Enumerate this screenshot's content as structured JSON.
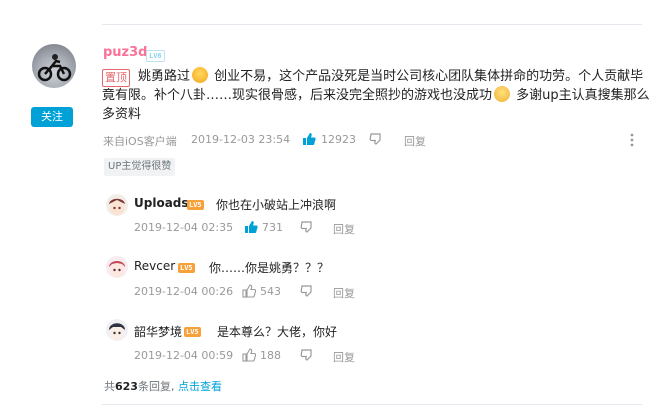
{
  "main_comment": {
    "username": "puz3d",
    "level": "LV6",
    "follow_label": "关注",
    "pinned_label": "置顶",
    "text_part1": "姚勇路过",
    "text_part2": "创业不易，这个产品没死是当时公司核心团队集体拼命的功劳。个人贡献毕竟有限。补个八卦……现实很骨感，后来没完全照抄的游戏也没成功",
    "text_part3": "多谢up主认真搜集那么多资料",
    "source": "来自iOS客户端",
    "timestamp": "2019-12-03 23:54",
    "likes": "12923",
    "reply_label": "回复",
    "up_liked_badge": "UP主觉得很赞"
  },
  "replies": [
    {
      "username": "Uploads",
      "level": "LV5",
      "text": "你也在小破站上冲浪啊",
      "timestamp": "2019-12-04 02:35",
      "likes": "731",
      "reply_label": "回复",
      "liked": true
    },
    {
      "username": "Revcer",
      "level": "LV5",
      "text": "你……你是姚勇？？？",
      "timestamp": "2019-12-04 00:26",
      "likes": "543",
      "reply_label": "回复",
      "liked": false
    },
    {
      "username": "韶华梦境",
      "level": "LV5",
      "text": "是本尊么？大佬，你好",
      "timestamp": "2019-12-04 00:59",
      "likes": "188",
      "reply_label": "回复",
      "liked": false
    }
  ],
  "footer": {
    "prefix": "共",
    "count": "623",
    "suffix": "条回复,",
    "view_link": "点击查看"
  },
  "colors": {
    "accent": "#00a1d6",
    "pinned": "#e4686b",
    "level_orange": "#f8a13b",
    "meta": "#999999"
  },
  "icons": [
    "thumb-up-icon",
    "thumb-down-icon",
    "more-icon"
  ]
}
